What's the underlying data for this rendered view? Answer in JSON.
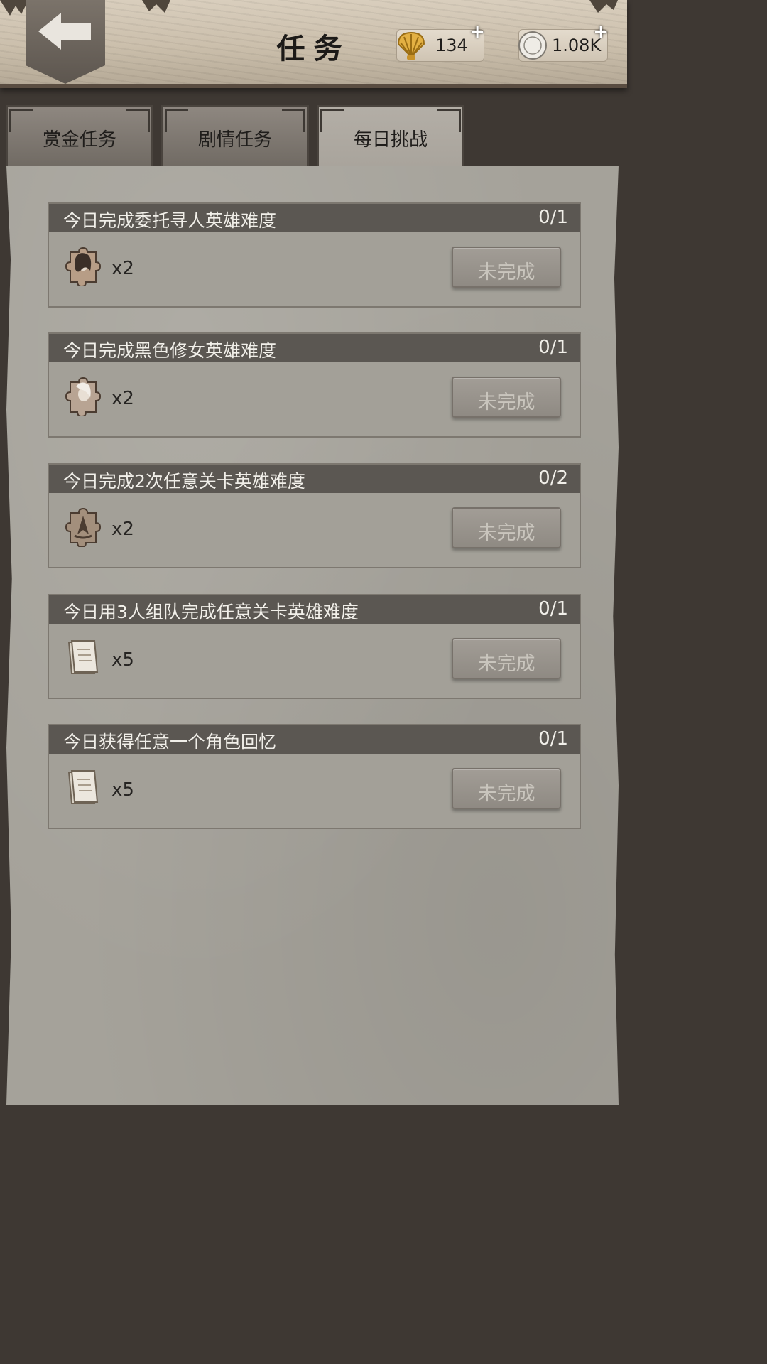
{
  "header": {
    "title": "任务",
    "currencies": [
      {
        "icon": "shell-icon",
        "value": "134",
        "plus": "+"
      },
      {
        "icon": "coin-icon",
        "value": "1.08K",
        "plus": "+"
      }
    ]
  },
  "tabs": [
    {
      "label": "赏金任务",
      "active": false
    },
    {
      "label": "剧情任务",
      "active": false
    },
    {
      "label": "每日挑战",
      "active": true
    }
  ],
  "quests": [
    {
      "name": "今日完成委托寻人英雄难度",
      "progress": "0/1",
      "reward_icon": "portrait-puzzle-icon",
      "reward_qty": "x2",
      "button": "未完成"
    },
    {
      "name": "今日完成黑色修女英雄难度",
      "progress": "0/1",
      "reward_icon": "portrait-puzzle-icon",
      "reward_qty": "x2",
      "button": "未完成"
    },
    {
      "name": "今日完成2次任意关卡英雄难度",
      "progress": "0/2",
      "reward_icon": "emblem-puzzle-icon",
      "reward_qty": "x2",
      "button": "未完成"
    },
    {
      "name": "今日用3人组队完成任意关卡英雄难度",
      "progress": "0/1",
      "reward_icon": "scroll-icon",
      "reward_qty": "x5",
      "button": "未完成"
    },
    {
      "name": "今日获得任意一个角色回忆",
      "progress": "0/1",
      "reward_icon": "scroll-icon",
      "reward_qty": "x5",
      "button": "未完成"
    }
  ]
}
